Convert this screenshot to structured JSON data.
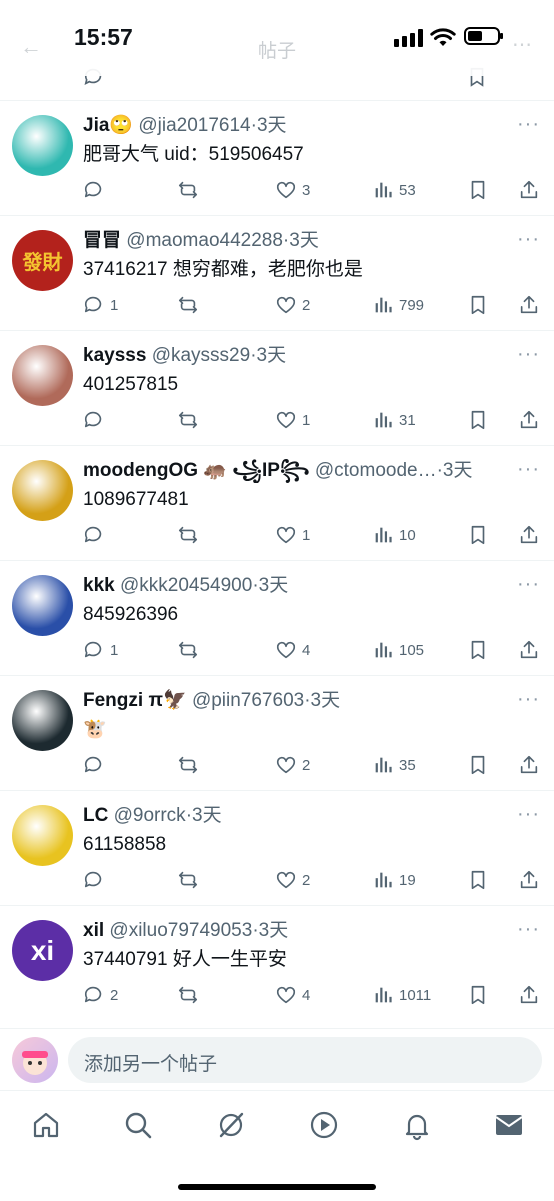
{
  "status_bar": {
    "time": "15:57"
  },
  "header": {
    "title": "帖子"
  },
  "posts": [
    {
      "name": "Jia🙄",
      "handle": "@jia2017614",
      "time": "3天",
      "content": "肥哥大气 uid：519506457",
      "replies": "",
      "reposts": "",
      "likes": "3",
      "views": "53",
      "avatar_color": "#2fb8b0",
      "avatar_text": ""
    },
    {
      "name": "冒冒",
      "handle": "@maomao442288",
      "time": "3天",
      "content": "37416217  想穷都难，老肥你也是",
      "replies": "1",
      "reposts": "",
      "likes": "2",
      "views": "799",
      "avatar_color": "#b3221c",
      "avatar_text": "發財"
    },
    {
      "name": "kaysss",
      "handle": "@kaysss29",
      "time": "3天",
      "content": "401257815",
      "replies": "",
      "reposts": "",
      "likes": "1",
      "views": "31",
      "avatar_color": "#b06a5a",
      "avatar_text": ""
    },
    {
      "name": "moodengOG 🦛 ꧁IP꧂",
      "handle": "@ctomoode…",
      "time": "3天",
      "content": "1089677481",
      "replies": "",
      "reposts": "",
      "likes": "1",
      "views": "10",
      "avatar_color": "#d4a017",
      "avatar_text": ""
    },
    {
      "name": "kkk",
      "handle": "@kkk20454900",
      "time": "3天",
      "content": "845926396",
      "replies": "1",
      "reposts": "",
      "likes": "4",
      "views": "105",
      "avatar_color": "#2a4fa8",
      "avatar_text": ""
    },
    {
      "name": "Fengzi π🦅",
      "handle": "@piin767603",
      "time": "3天",
      "content": "🐮",
      "replies": "",
      "reposts": "",
      "likes": "2",
      "views": "35",
      "avatar_color": "#1d2a30",
      "avatar_text": ""
    },
    {
      "name": "LC",
      "handle": "@9orrck",
      "time": "3天",
      "content": "61158858",
      "replies": "",
      "reposts": "",
      "likes": "2",
      "views": "19",
      "avatar_color": "#e8c320",
      "avatar_text": ""
    },
    {
      "name": "xil",
      "handle": "@xiluo79749053",
      "time": "3天",
      "content": "37440791    好人一生平安",
      "replies": "2",
      "reposts": "",
      "likes": "4",
      "views": "1011",
      "avatar_color": "#5c2ea6",
      "avatar_text": "xi"
    }
  ],
  "composer": {
    "placeholder": "添加另一个帖子"
  },
  "icons": {
    "tab1": "home-icon",
    "tab2": "search-icon",
    "tab3": "grok-icon",
    "tab4": "video-icon",
    "tab5": "bell-icon",
    "tab6": "mail-icon"
  }
}
